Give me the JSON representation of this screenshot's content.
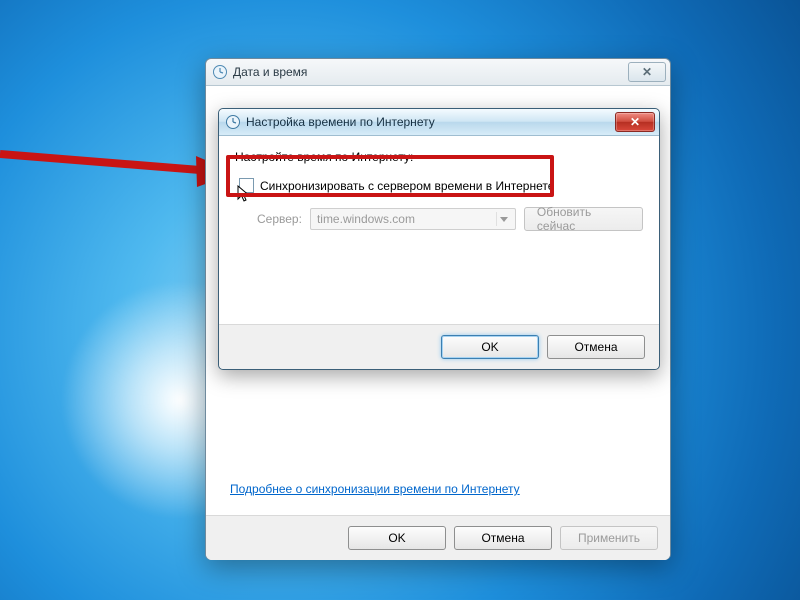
{
  "outer_window": {
    "title": "Дата и время",
    "link": "Подробнее о синхронизации времени по Интернету",
    "buttons": {
      "ok": "OK",
      "cancel": "Отмена",
      "apply": "Применить"
    }
  },
  "inner_dialog": {
    "title": "Настройка времени по Интернету",
    "prompt": "Настройте время по Интернету:",
    "checkbox_label": "Синхронизировать с сервером времени в Интернете",
    "checkbox_checked": false,
    "server_label": "Сервер:",
    "server_value": "time.windows.com",
    "update_now": "Обновить сейчас",
    "buttons": {
      "ok": "OK",
      "cancel": "Отмена"
    }
  },
  "annotation": {
    "highlight_color": "#c91414"
  }
}
